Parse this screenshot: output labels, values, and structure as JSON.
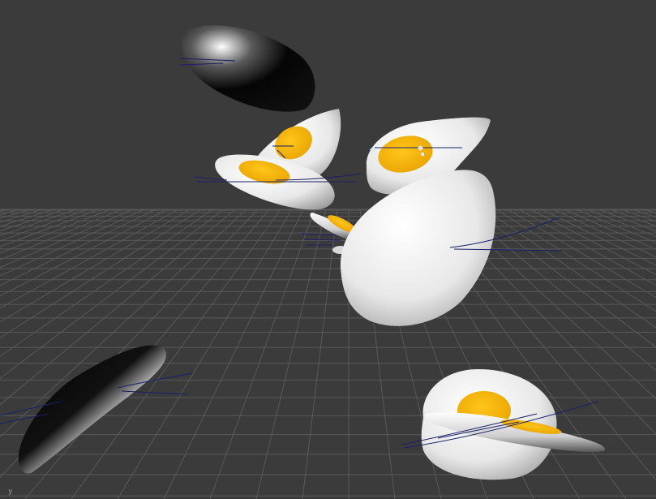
{
  "viewport": {
    "background": "#3b3b3b",
    "grid_color": "#595959",
    "egg_white_color": "#eeeeee",
    "egg_yolk_color": "#f2b300",
    "curve_color": "#1b1f6a",
    "handle_color": "#dfe6ee",
    "axis_label": "y"
  },
  "objects": [
    {
      "name": "dark-egg-top",
      "kind": "egg-dark"
    },
    {
      "name": "egg-upper-left",
      "kind": "fried-egg"
    },
    {
      "name": "egg-left",
      "kind": "fried-egg"
    },
    {
      "name": "egg-upper-right",
      "kind": "fried-egg"
    },
    {
      "name": "egg-large-center",
      "kind": "egg-white"
    },
    {
      "name": "egg-edge-center",
      "kind": "fried-egg-edge"
    },
    {
      "name": "dark-egg-lower-left",
      "kind": "egg-dark-edge"
    },
    {
      "name": "egg-lower-right",
      "kind": "fried-egg"
    },
    {
      "name": "egg-edge-lower-right",
      "kind": "egg-edge"
    }
  ]
}
